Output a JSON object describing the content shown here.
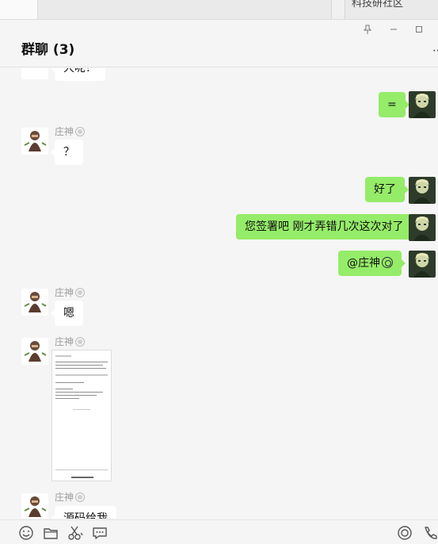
{
  "background_window": {
    "partial_text": "科技研社区"
  },
  "chat": {
    "title": "群聊 (3)",
    "window_controls": {
      "pin": "pin-icon",
      "minimize": "minimize-icon",
      "maximize": "maximize-icon",
      "more": "more-icon"
    }
  },
  "messages": [
    {
      "side": "in",
      "sender": "",
      "text": "大呢？",
      "partial": true
    },
    {
      "side": "out",
      "text": "="
    },
    {
      "side": "in",
      "sender": "庄神",
      "text": "？"
    },
    {
      "side": "out",
      "text": "好了"
    },
    {
      "side": "out",
      "text": "您签署吧 刚才弄错几次这次对了"
    },
    {
      "side": "out",
      "text": "@庄神",
      "trailing_icon": "mention-emoji-icon"
    },
    {
      "side": "in",
      "sender": "庄神",
      "text": "嗯"
    },
    {
      "side": "in",
      "sender": "庄神",
      "type": "image",
      "description_icon": "phone-screenshot-image"
    },
    {
      "side": "in",
      "sender": "庄神",
      "text": "源码给我",
      "partial": true
    }
  ],
  "toolbar": {
    "left": [
      "emoji-icon",
      "folder-icon",
      "scissors-icon",
      "chat-bubble-icon"
    ],
    "right": [
      "live-icon",
      "phone-icon"
    ]
  },
  "colors": {
    "outgoing_bubble": "#95ec69",
    "incoming_bubble": "#ffffff",
    "background": "#f5f5f5"
  }
}
